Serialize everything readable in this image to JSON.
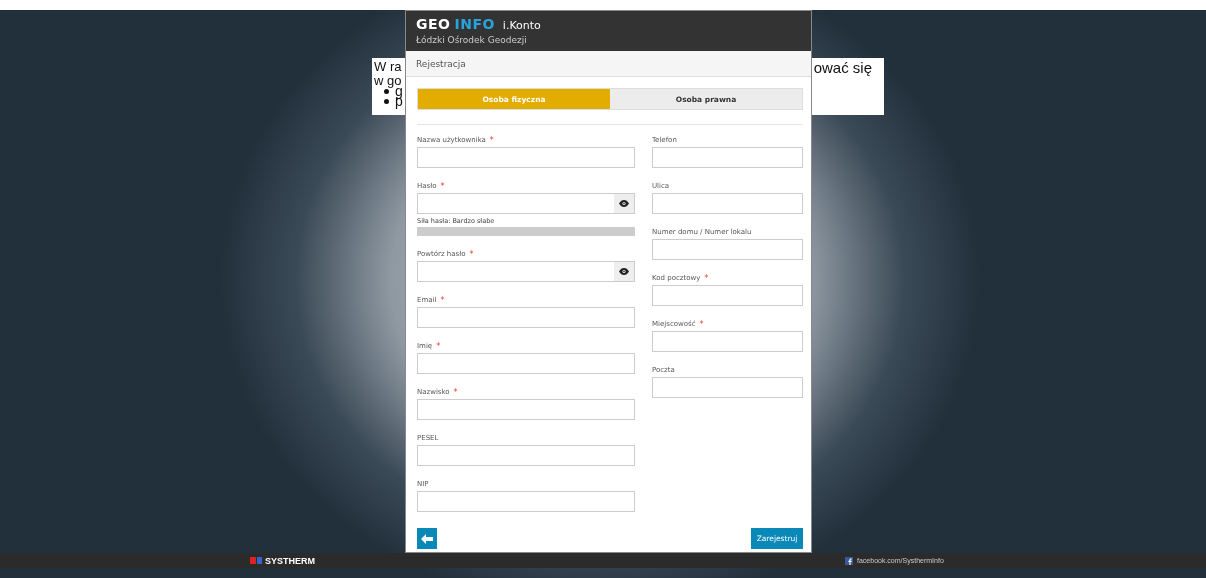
{
  "background_notice": {
    "lines": [
      "W ra",
      "w go"
    ],
    "right_text": "ować się",
    "bullets": [
      "g",
      "p"
    ]
  },
  "modal": {
    "logo": {
      "part_1": "GEO",
      "part_2": "INFO"
    },
    "app_name": "i.Konto",
    "subtitle": "Łódzki Ośrodek Geodezji",
    "heading": "Rejestracja",
    "tabs": [
      {
        "label": "Osoba fizyczna",
        "selected": true
      },
      {
        "label": "Osoba prawna",
        "selected": false
      }
    ],
    "left_fields": [
      {
        "kind": "text",
        "label": "Nazwa użytkownika",
        "required_mark": "*"
      },
      {
        "kind": "password",
        "label": "Hasło",
        "required_mark": "*",
        "strength": {
          "label": "Siła hasła: Bardzo słabe",
          "level": 0
        }
      },
      {
        "kind": "password",
        "label": "Powtórz hasło",
        "required_mark": "*"
      },
      {
        "kind": "text",
        "label": "Email",
        "required_mark": "*"
      },
      {
        "kind": "text",
        "label": "Imię",
        "required_mark": "*"
      },
      {
        "kind": "text",
        "label": "Nazwisko",
        "required_mark": "*"
      },
      {
        "kind": "text",
        "label": "PESEL"
      },
      {
        "kind": "text",
        "label": "NIP"
      }
    ],
    "right_fields": [
      {
        "kind": "text",
        "label": "Telefon"
      },
      {
        "kind": "text",
        "label": "Ulica"
      },
      {
        "kind": "text",
        "label": "Numer domu / Numer lokalu"
      },
      {
        "kind": "text",
        "label": "Kod pocztowy",
        "required_mark": "*"
      },
      {
        "kind": "text",
        "label": "Miejscowość",
        "required_mark": "*"
      },
      {
        "kind": "text",
        "label": "Poczta"
      }
    ],
    "submit": "Zarejestruj"
  },
  "footer_bar": {
    "brand": "SYSTHERM",
    "facebook": "facebook.com/SysthermInfo"
  }
}
